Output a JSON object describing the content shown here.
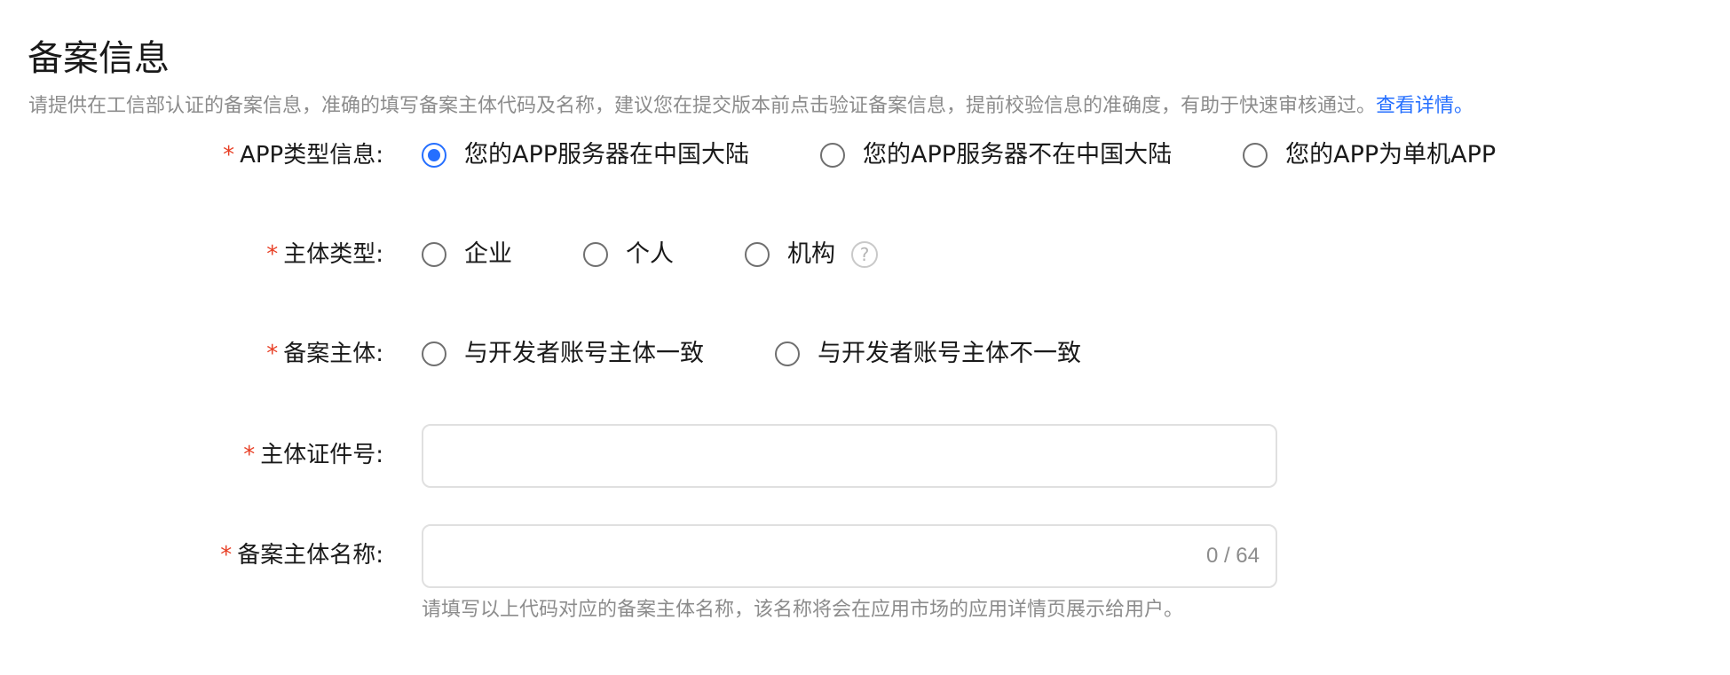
{
  "section": {
    "title": "备案信息",
    "description": "请提供在工信部认证的备案信息，准确的填写备案主体代码及名称，建议您在提交版本前点击验证备案信息，提前校验信息的准确度，有助于快速审核通过。",
    "detail_link": "查看详情。"
  },
  "form": {
    "required_mark": "*",
    "app_type": {
      "label": "APP类型信息:",
      "options": [
        {
          "label": "您的APP服务器在中国大陆",
          "checked": true
        },
        {
          "label": "您的APP服务器不在中国大陆",
          "checked": false
        },
        {
          "label": "您的APP为单机APP",
          "checked": false
        }
      ]
    },
    "subject_type": {
      "label": "主体类型:",
      "options": [
        {
          "label": "企业",
          "checked": false
        },
        {
          "label": "个人",
          "checked": false
        },
        {
          "label": "机构",
          "checked": false
        }
      ],
      "help_icon": "question-circle-icon",
      "help_glyph": "?"
    },
    "filing_subject": {
      "label": "备案主体:",
      "options": [
        {
          "label": "与开发者账号主体一致",
          "checked": false
        },
        {
          "label": "与开发者账号主体不一致",
          "checked": false
        }
      ]
    },
    "subject_id": {
      "label": "主体证件号:",
      "value": "",
      "placeholder": ""
    },
    "subject_name": {
      "label": "备案主体名称:",
      "value": "",
      "placeholder": "",
      "counter": "0 / 64",
      "hint": "请填写以上代码对应的备案主体名称，该名称将会在应用市场的应用详情页展示给用户。"
    }
  },
  "colors": {
    "accent": "#256fff",
    "required": "#e84026",
    "muted_text": "#8c8c8c",
    "border": "#e0e0e0"
  }
}
